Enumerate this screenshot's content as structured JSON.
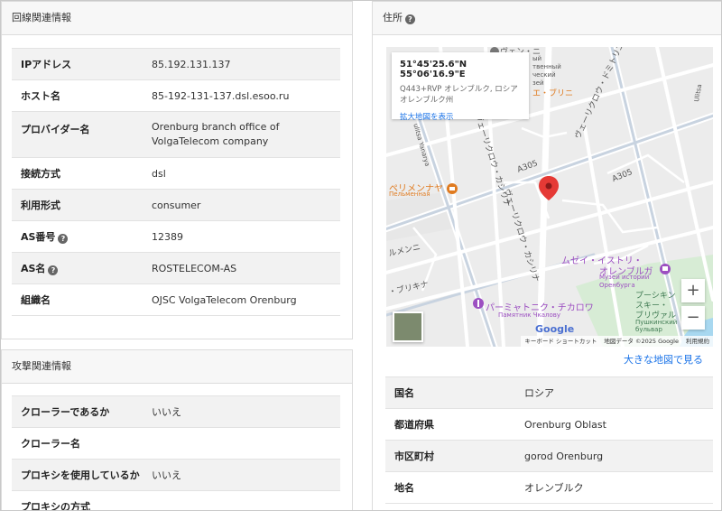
{
  "line_panel": {
    "title": "回線関連情報",
    "rows": [
      {
        "label": "IPアドレス",
        "value": "85.192.131.137"
      },
      {
        "label": "ホスト名",
        "value": "85-192-131-137.dsl.esoo.ru"
      },
      {
        "label": "プロバイダー名",
        "value": "Orenburg branch office of VolgaTelecom company"
      },
      {
        "label": "接続方式",
        "value": "dsl"
      },
      {
        "label": "利用形式",
        "value": "consumer"
      },
      {
        "label": "AS番号",
        "value": "12389"
      },
      {
        "label": "AS名",
        "value": "ROSTELECOM-AS"
      },
      {
        "label": "組織名",
        "value": "OJSC VolgaTelecom Orenburg"
      }
    ]
  },
  "attack_panel": {
    "title": "攻撃関連情報",
    "rows": [
      {
        "label": "クローラーであるか",
        "value": "いいえ"
      },
      {
        "label": "クローラー名",
        "value": ""
      },
      {
        "label": "プロキシを使用しているか",
        "value": "いいえ"
      },
      {
        "label": "プロキシの方式",
        "value": ""
      }
    ]
  },
  "address_panel": {
    "title": "住所",
    "help_icon": "?",
    "map": {
      "coordinates": "51°45'25.6\"N 55°06'16.9\"E",
      "address": "Q443+RVP オレンブルク, ロシア オレンブルク州",
      "enlarge_link": "拡大地図を表示",
      "zoom_in": "+",
      "zoom_out": "−",
      "google_logo": "Google",
      "footer": {
        "shortcuts": "キーボード ショートカット",
        "data": "地図データ ©2025 Google",
        "terms": "利用規約"
      },
      "labels": {
        "a305_1": "A305",
        "a305_2": "A305",
        "pelmennaya_ja": "ペリメンナヤ",
        "pelmennaya_ru": "Пельменная",
        "museum_ja_1": "ムゼイ・イストリ・",
        "museum_ja_2": "オレンブルガ",
        "museum_ru_1": "Музей истории",
        "museum_ru_2": "Оренбурга",
        "chkalov_ja": "パーミャトニク・チカロワ",
        "chkalov_ru": "Памятник Чкалову",
        "pushkin_ja_1": "プーシキン",
        "pushkin_ja_2": "スキー・",
        "pushkin_ja_3": "ブリヴァル",
        "pushkin_ru_1": "Пушкинский",
        "pushkin_ru_2": "бульвар",
        "street_1": "ヴェーリクロウ・ドミトリエフスキー",
        "street_2": "ヴェーリクロウ・カシリナ",
        "street_3": "ヴェーリクロウ・カシリナ",
        "street_4": "・ブリキナ",
        "street_5": "ルメンニ",
        "street_6": "ulitsa Yanarya",
        "street_7": "Ulitsa",
        "poi_top": "ヴェン・ニ",
        "poi_top_ru_1": "ый",
        "poi_top_ru_2": "твенный",
        "poi_top_ru_3": "ческий",
        "poi_top_ru_4": "зей",
        "poi_brini": "エ・ブリニ"
      }
    },
    "larger_map_link": "大きな地図で見る",
    "rows": [
      {
        "label": "国名",
        "value": "ロシア"
      },
      {
        "label": "都道府県",
        "value": "Orenburg Oblast"
      },
      {
        "label": "市区町村",
        "value": "gorod Orenburg"
      },
      {
        "label": "地名",
        "value": "オレンブルク"
      }
    ]
  },
  "colors": {
    "alt_row": "#f2f2f2",
    "link": "#1a73e8",
    "marker": "#e53935",
    "map_bg": "#eeeeee"
  }
}
